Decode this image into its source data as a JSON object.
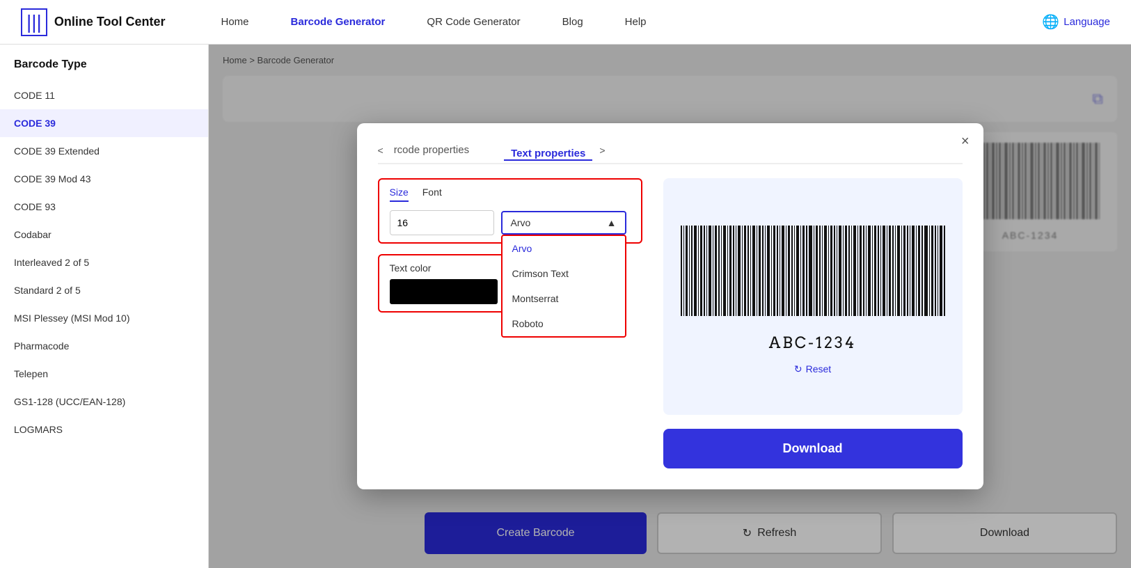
{
  "header": {
    "logo_text": "Online Tool Center",
    "nav": [
      {
        "label": "Home",
        "active": false
      },
      {
        "label": "Barcode Generator",
        "active": true
      },
      {
        "label": "QR Code Generator",
        "active": false
      },
      {
        "label": "Blog",
        "active": false
      },
      {
        "label": "Help",
        "active": false
      }
    ],
    "language_label": "Language"
  },
  "sidebar": {
    "title": "Barcode Type",
    "items": [
      {
        "label": "CODE 11",
        "active": false
      },
      {
        "label": "CODE 39",
        "active": true
      },
      {
        "label": "CODE 39 Extended",
        "active": false
      },
      {
        "label": "CODE 39 Mod 43",
        "active": false
      },
      {
        "label": "CODE 93",
        "active": false
      },
      {
        "label": "Codabar",
        "active": false
      },
      {
        "label": "Interleaved 2 of 5",
        "active": false
      },
      {
        "label": "Standard 2 of 5",
        "active": false
      },
      {
        "label": "MSI Plessey (MSI Mod 10)",
        "active": false
      },
      {
        "label": "Pharmacode",
        "active": false
      },
      {
        "label": "Telepen",
        "active": false
      },
      {
        "label": "GS1-128 (UCC/EAN-128)",
        "active": false
      },
      {
        "label": "LOGMARS",
        "active": false
      }
    ]
  },
  "breadcrumb": {
    "home": "Home",
    "separator": ">",
    "current": "Barcode Generator"
  },
  "bottom_buttons": {
    "create": "Create Barcode",
    "refresh": "Refresh",
    "download": "Download"
  },
  "modal": {
    "tab_prev_arrow": "<",
    "tab_prev_label": "rcode properties",
    "tab_active_label": "Text properties",
    "tab_next_arrow": ">",
    "close": "×",
    "size_tab": "Size",
    "font_tab": "Font",
    "size_value": "16",
    "font_selected": "Arvo",
    "font_options": [
      "Arvo",
      "Crimson Text",
      "Montserrat",
      "Roboto"
    ],
    "text_color_label": "Text color",
    "barcode_text": "ABC-1234",
    "reset_label": "Reset",
    "download_label": "Download"
  }
}
